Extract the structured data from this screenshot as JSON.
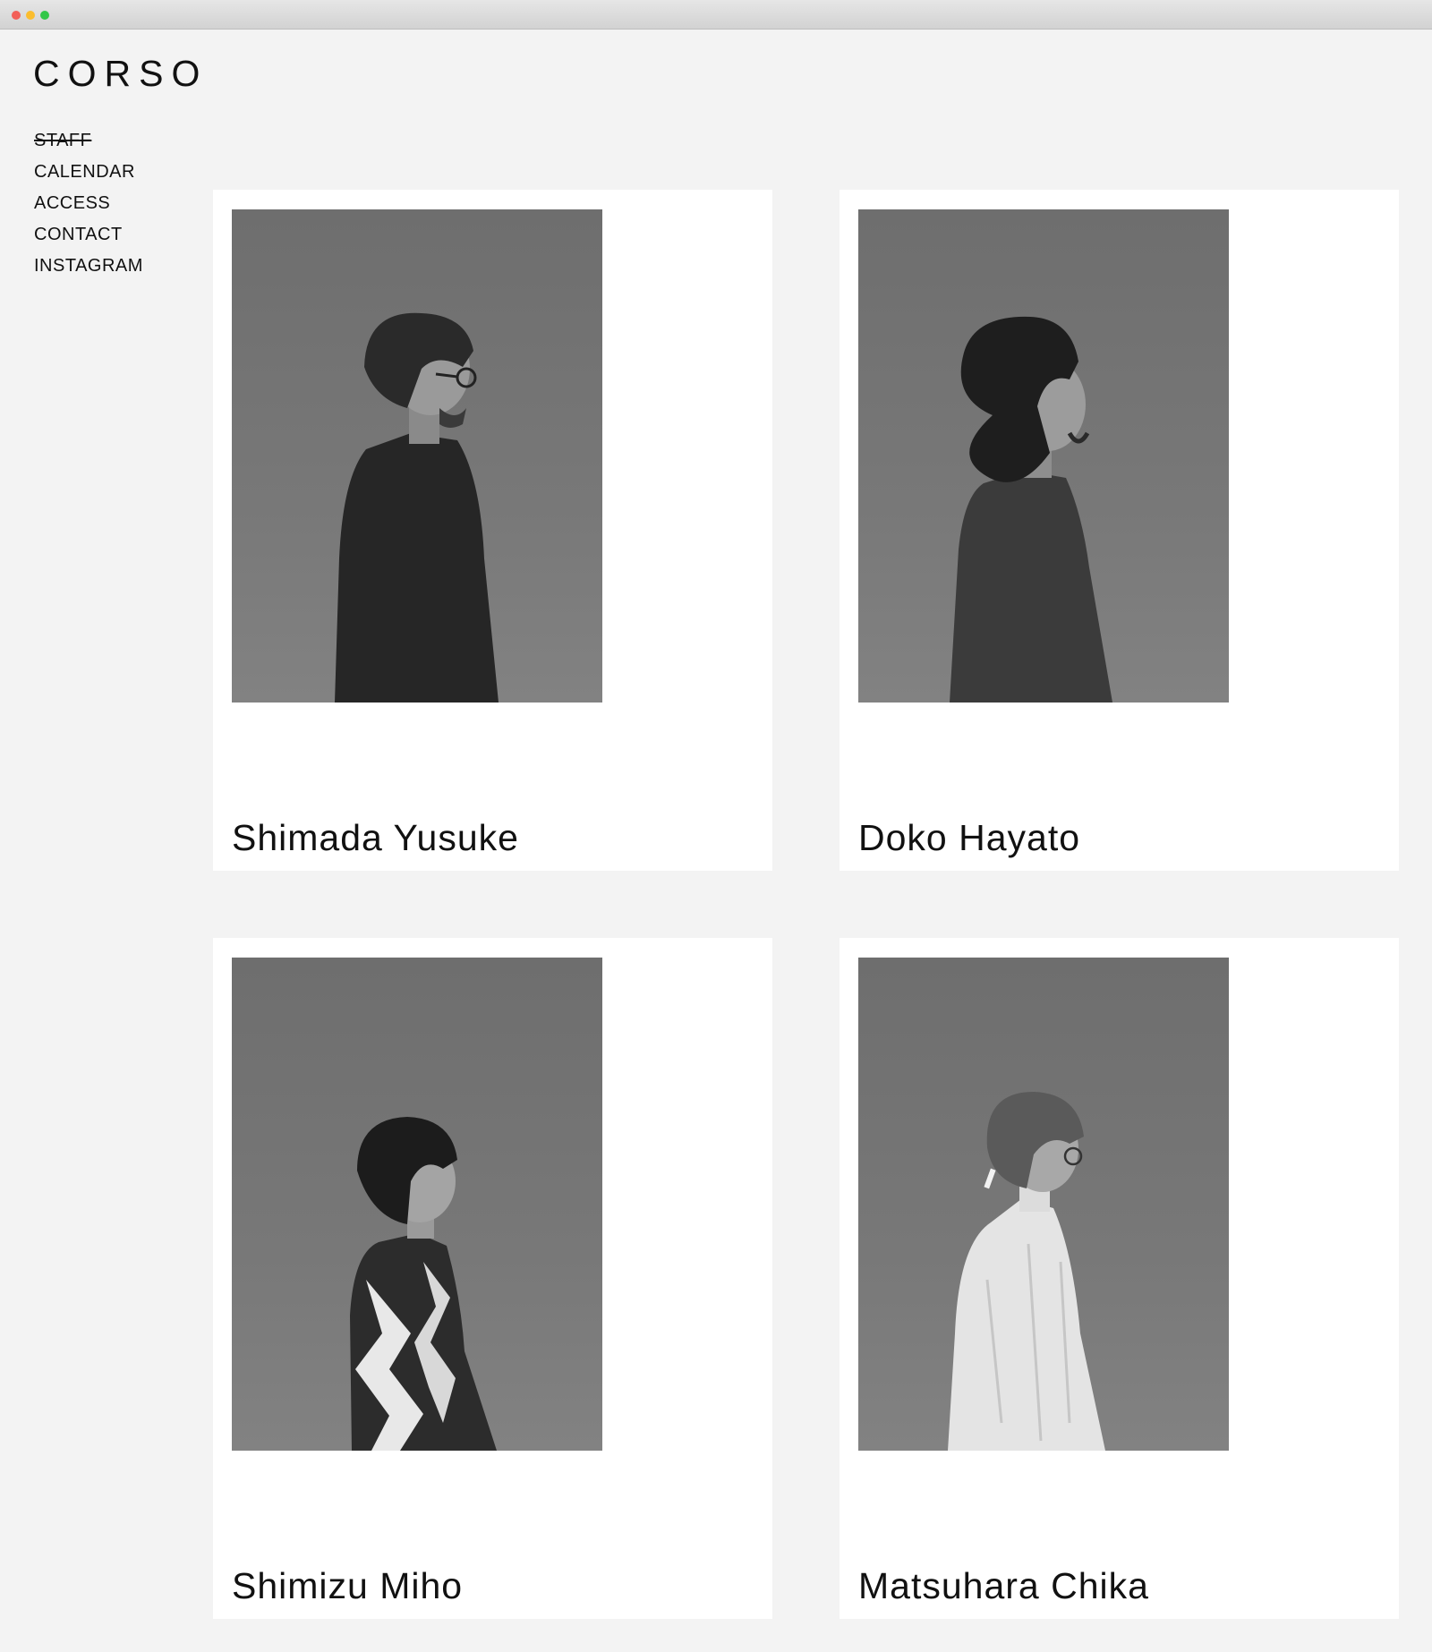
{
  "window": {
    "buttons": [
      "close",
      "minimize",
      "zoom"
    ]
  },
  "brand": {
    "logo": "CORSO"
  },
  "nav": {
    "items": [
      {
        "label": "STAFF",
        "active": true
      },
      {
        "label": "CALENDAR",
        "active": false
      },
      {
        "label": "ACCESS",
        "active": false
      },
      {
        "label": "CONTACT",
        "active": false
      },
      {
        "label": "INSTAGRAM",
        "active": false
      }
    ]
  },
  "staff": [
    {
      "name": "Shimada Yusuke"
    },
    {
      "name": "Doko Hayato"
    },
    {
      "name": "Shimizu Miho"
    },
    {
      "name": "Matsuhara Chika"
    }
  ],
  "colors": {
    "page_bg": "#f3f3f3",
    "card_bg": "#ffffff",
    "text": "#111111",
    "photo_bg": "#747474"
  }
}
